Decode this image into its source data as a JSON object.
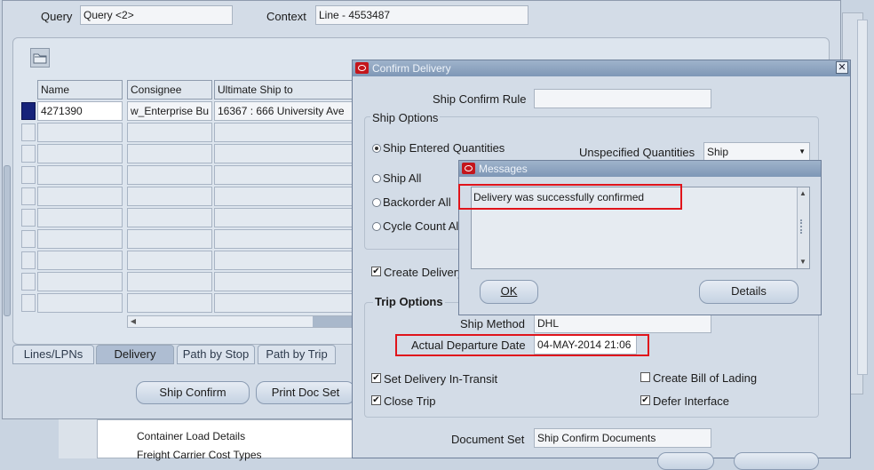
{
  "main_form": {
    "query_label": "Query",
    "query_value": "Query <2>",
    "context_label": "Context",
    "context_value": "Line - 4553487",
    "table": {
      "columns": [
        "Name",
        "Consignee",
        "Ultimate Ship to"
      ],
      "rows": [
        [
          "4271390",
          "w_Enterprise Bu",
          "16367 : 666 University Ave"
        ]
      ]
    },
    "tabs": [
      "Lines/LPNs",
      "Delivery",
      "Path by Stop",
      "Path by Trip"
    ],
    "active_tab": "Delivery",
    "ship_confirm_button": "Ship Confirm",
    "print_doc_set_button": "Print Doc Set",
    "background_list": [
      "Container Load Details",
      "Freight Carrier Cost Types"
    ]
  },
  "confirm_delivery": {
    "title": "Confirm Delivery",
    "ship_confirm_rule_label": "Ship Confirm Rule",
    "ship_confirm_rule_value": "",
    "ship_options_label": "Ship Options",
    "radio_ship_entered": "Ship Entered Quantities",
    "radio_ship_all": "Ship All",
    "radio_backorder_all": "Backorder All",
    "radio_cycle_count": "Cycle Count All",
    "unspecified_label": "Unspecified Quantities",
    "unspecified_value": "Ship",
    "create_delivery_label": "Create Delivery",
    "trip_options_label": "Trip Options",
    "ship_method_label": "Ship Method",
    "ship_method_value": "DHL",
    "departure_label": "Actual Departure Date",
    "departure_value": "04-MAY-2014 21:06",
    "set_in_transit": "Set Delivery In-Transit",
    "close_trip": "Close Trip",
    "create_bol": "Create Bill of Lading",
    "defer_interface": "Defer Interface",
    "document_set_label": "Document Set",
    "document_set_value": "Ship Confirm Documents"
  },
  "messages": {
    "title": "Messages",
    "text": "Delivery was successfully confirmed",
    "ok_button": "OK",
    "details_button": "Details"
  },
  "colors": {
    "background": "#c9d4e1",
    "highlight_box": "#e0141b",
    "selected_row_marker": "#16237a"
  },
  "icons": [
    "folder-icon",
    "oracle-logo-icon",
    "close-icon",
    "dropdown-arrow-icon",
    "scroll-up-icon",
    "scroll-down-icon"
  ]
}
